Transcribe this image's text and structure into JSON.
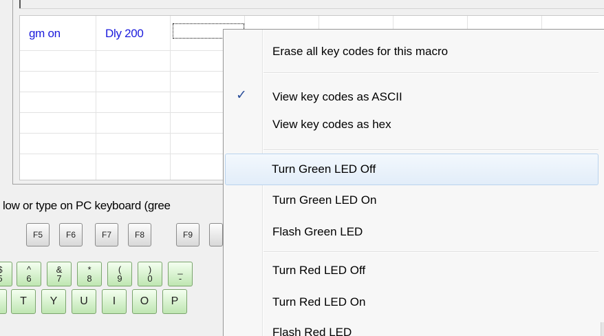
{
  "grid": {
    "rows": [
      {
        "cells": [
          "gm on",
          "Dly 200",
          ""
        ]
      }
    ]
  },
  "keyboard": {
    "instruction": "low or type on PC keyboard (gree",
    "function_keys": [
      "F5",
      "F6",
      "F7",
      "F8",
      "F9",
      ""
    ],
    "number_keys": [
      {
        "top": "$",
        "bottom": "5"
      },
      {
        "top": "^",
        "bottom": "6"
      },
      {
        "top": "&",
        "bottom": "7"
      },
      {
        "top": "*",
        "bottom": "8"
      },
      {
        "top": "(",
        "bottom": "9"
      },
      {
        "top": ")",
        "bottom": "0"
      },
      {
        "top": "_",
        "bottom": "-"
      }
    ],
    "letter_keys": [
      "",
      "T",
      "Y",
      "U",
      "I",
      "O",
      "P"
    ]
  },
  "context_menu": {
    "items": [
      {
        "label": "Erase all key codes for this macro",
        "checked": false
      },
      {
        "label": "View key codes as ASCII",
        "checked": true
      },
      {
        "label": "View key codes as hex",
        "checked": false
      },
      {
        "label": "Turn Green LED Off",
        "checked": false,
        "highlighted": true
      },
      {
        "label": "Turn Green LED On",
        "checked": false
      },
      {
        "label": "Flash Green LED",
        "checked": false
      },
      {
        "label": "Turn Red LED Off",
        "checked": false
      },
      {
        "label": "Turn Red LED On",
        "checked": false
      },
      {
        "label": "Flash Red LED",
        "checked": false
      }
    ],
    "check_glyph": "✓"
  },
  "colors": {
    "cell_text": "#1a1adc",
    "hover_border": "#b9d3ee",
    "key_green": "#bfe6b2",
    "check_mark": "#2b4e9a"
  }
}
